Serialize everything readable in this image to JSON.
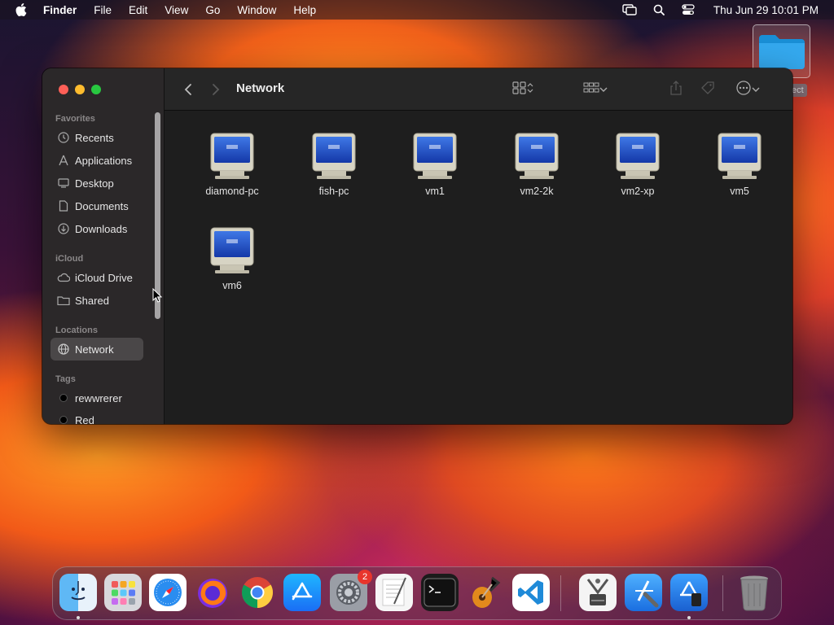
{
  "menubar": {
    "app_name": "Finder",
    "items": [
      "File",
      "Edit",
      "View",
      "Go",
      "Window",
      "Help"
    ],
    "clock": "Thu Jun 29  10:01 PM",
    "status_icons": [
      "screen-mirroring-icon",
      "spotlight-icon",
      "control-center-icon"
    ]
  },
  "desktop": {
    "folder_label": "ect"
  },
  "finder": {
    "title": "Network",
    "sidebar": {
      "favorites_header": "Favorites",
      "favorites": [
        {
          "label": "Recents",
          "icon": "clock-icon"
        },
        {
          "label": "Applications",
          "icon": "applications-icon"
        },
        {
          "label": "Desktop",
          "icon": "desktop-icon"
        },
        {
          "label": "Documents",
          "icon": "document-icon"
        },
        {
          "label": "Downloads",
          "icon": "download-icon"
        }
      ],
      "icloud_header": "iCloud",
      "icloud": [
        {
          "label": "iCloud Drive",
          "icon": "cloud-icon"
        },
        {
          "label": "Shared",
          "icon": "shared-folder-icon"
        }
      ],
      "locations_header": "Locations",
      "locations": [
        {
          "label": "Network",
          "icon": "globe-icon",
          "selected": true
        }
      ],
      "tags_header": "Tags",
      "tags": [
        {
          "label": "rewwrerer",
          "color": "#000000"
        },
        {
          "label": "Red",
          "color": "#000000"
        }
      ]
    },
    "items": [
      {
        "label": "diamond-pc"
      },
      {
        "label": "fish-pc"
      },
      {
        "label": "vm1"
      },
      {
        "label": "vm2-2k"
      },
      {
        "label": "vm2-xp"
      },
      {
        "label": "vm5"
      },
      {
        "label": "vm6"
      }
    ]
  },
  "dock": {
    "apps": [
      {
        "name": "Finder",
        "icon": "finder-icon",
        "running": true
      },
      {
        "name": "Launchpad",
        "icon": "launchpad-icon",
        "running": false
      },
      {
        "name": "Safari",
        "icon": "safari-icon",
        "running": false
      },
      {
        "name": "Firefox",
        "icon": "firefox-icon",
        "running": false
      },
      {
        "name": "Chrome",
        "icon": "chrome-icon",
        "running": false
      },
      {
        "name": "App Store",
        "icon": "app-store-icon",
        "running": false
      },
      {
        "name": "System Settings",
        "icon": "settings-icon",
        "running": false,
        "badge": "2"
      },
      {
        "name": "TextEdit",
        "icon": "textedit-icon",
        "running": false
      },
      {
        "name": "Terminal",
        "icon": "terminal-icon",
        "running": false
      },
      {
        "name": "GarageBand",
        "icon": "garageband-icon",
        "running": false
      },
      {
        "name": "VS Code",
        "icon": "vscode-icon",
        "running": false
      },
      {
        "name": "System Information",
        "icon": "system-info-icon",
        "running": false
      },
      {
        "name": "Xcode",
        "icon": "xcode-icon",
        "running": false
      },
      {
        "name": "Simulator",
        "icon": "simulator-icon",
        "running": true
      },
      {
        "name": "Trash",
        "icon": "trash-icon",
        "running": false
      }
    ]
  },
  "colors": {
    "sidebar_bg": "#2b2829",
    "content_bg": "#1e1e1e",
    "selected_bg": "#4a4748",
    "close": "#fe5f57",
    "minimize": "#febc2e",
    "maximize": "#28c840"
  }
}
